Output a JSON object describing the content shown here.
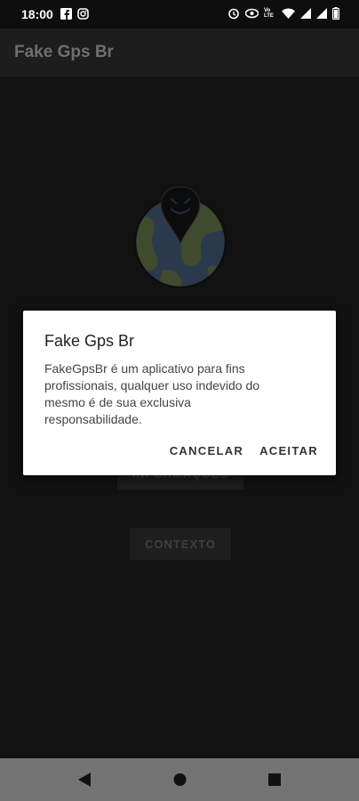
{
  "status_bar": {
    "time": "18:00",
    "left_icons": [
      "facebook-icon",
      "instagram-icon"
    ],
    "right_icons": [
      "alarm-icon",
      "eye-icon",
      "volte-icon",
      "wifi-icon",
      "signal-icon",
      "signal-icon",
      "battery-icon"
    ],
    "volte_label": "Vo LTE"
  },
  "app_bar": {
    "title": "Fake Gps Br"
  },
  "main": {
    "info_button_label": "INFORMAÇÕES",
    "context_button_label": "CONTEXTO"
  },
  "dialog": {
    "title": "Fake Gps Br",
    "message": "FakeGpsBr é um aplicativo para fins profissionais, qualquer uso indevido do mesmo é de sua exclusiva responsabilidade.",
    "cancel_label": "CANCELAR",
    "accept_label": "ACEITAR"
  },
  "nav_bar": {
    "buttons": [
      "back-icon",
      "home-icon",
      "recents-icon"
    ]
  },
  "colors": {
    "dialog_bg": "#ffffff",
    "background": "#121212",
    "nav_bar": "#747474"
  }
}
